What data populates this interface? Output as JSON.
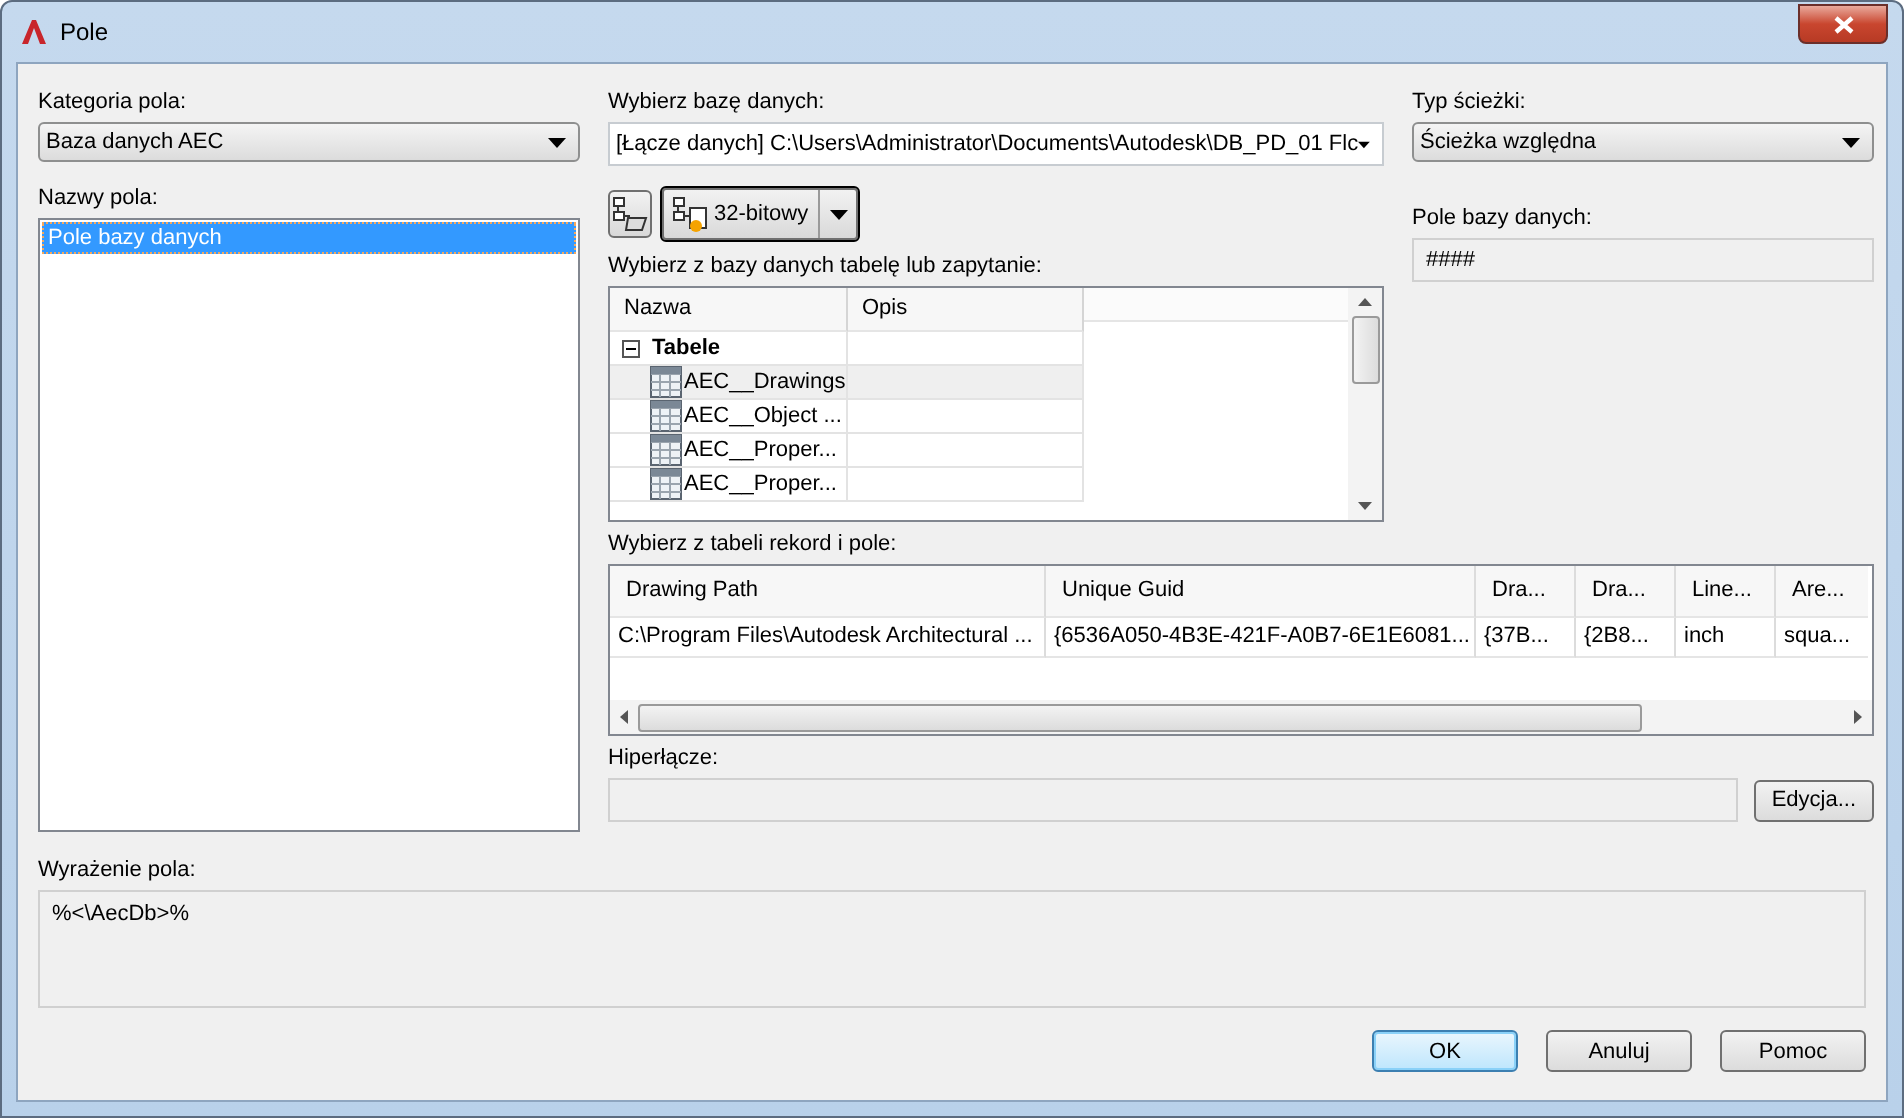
{
  "window": {
    "title": "Pole"
  },
  "category": {
    "label": "Kategoria pola:",
    "value": "Baza danych AEC"
  },
  "field_names": {
    "label": "Nazwy pola:",
    "items": [
      {
        "label": "Pole bazy danych",
        "selected": true
      }
    ]
  },
  "database": {
    "label": "Wybierz bazę danych:",
    "value": "[Łącze danych] C:\\Users\\Administrator\\Documents\\Autodesk\\DB_PD_01 Flc"
  },
  "toolbar": {
    "split_button": "32-bitowy"
  },
  "table_picker": {
    "label": "Wybierz z bazy danych tabelę lub zapytanie:",
    "columns": [
      "Nazwa",
      "Opis"
    ],
    "tree": [
      {
        "label": "Tabele",
        "expanded": true,
        "children": [
          {
            "label": "AEC__Drawings"
          },
          {
            "label": "AEC__Object ..."
          },
          {
            "label": "AEC__Proper..."
          },
          {
            "label": "AEC__Proper..."
          }
        ]
      }
    ]
  },
  "records": {
    "label": "Wybierz z tabeli rekord i pole:",
    "columns": [
      "Drawing Path",
      "Unique Guid",
      "Dra...",
      "Dra...",
      "Line...",
      "Are..."
    ],
    "rows": [
      [
        "C:\\Program Files\\Autodesk Architectural ...",
        "{6536A050-4B3E-421F-A0B7-6E1E6081...",
        "{37B...",
        "{2B8...",
        "inch",
        "squa..."
      ]
    ]
  },
  "hyperlink": {
    "label": "Hiperłącze:",
    "button": "Edycja..."
  },
  "path_type": {
    "label": "Typ ścieżki:",
    "value": "Ścieżka względna"
  },
  "db_field": {
    "label": "Pole bazy danych:",
    "value": "####"
  },
  "expression": {
    "label": "Wyrażenie pola:",
    "value": "%<\\AecDb>%"
  },
  "buttons": [
    {
      "label": "OK",
      "default": true
    },
    {
      "label": "Anuluj",
      "default": false
    },
    {
      "label": "Pomoc",
      "default": false
    }
  ]
}
